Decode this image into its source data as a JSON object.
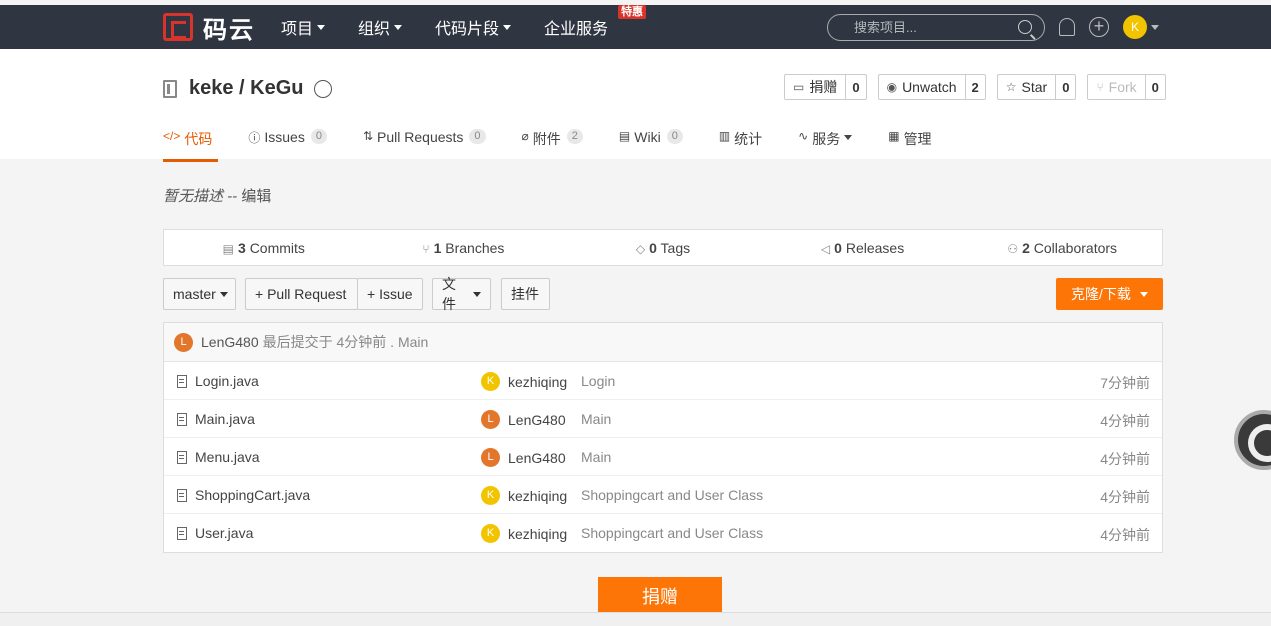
{
  "nav": {
    "logo_text": "码云",
    "items": [
      {
        "label": "项目",
        "dropdown": true
      },
      {
        "label": "组织",
        "dropdown": true
      },
      {
        "label": "代码片段",
        "dropdown": true
      },
      {
        "label": "企业服务",
        "dropdown": false,
        "badge": "特惠"
      }
    ],
    "search_placeholder": "搜索项目...",
    "avatar_letter": "K"
  },
  "repo": {
    "title": "keke / KeGu",
    "actions": [
      {
        "label": "捐赠",
        "count": "0",
        "disabled": false,
        "icon": "donate-icon"
      },
      {
        "label": "Unwatch",
        "count": "2",
        "disabled": false,
        "icon": "eye-icon"
      },
      {
        "label": "Star",
        "count": "0",
        "disabled": false,
        "icon": "star-icon"
      },
      {
        "label": "Fork",
        "count": "0",
        "disabled": true,
        "icon": "fork-icon"
      }
    ],
    "tabs": [
      {
        "label": "代码",
        "count": "",
        "active": true,
        "icon": "code-icon"
      },
      {
        "label": "Issues",
        "count": "0",
        "active": false,
        "icon": "issue-icon"
      },
      {
        "label": "Pull Requests",
        "count": "0",
        "active": false,
        "icon": "pull-request-icon"
      },
      {
        "label": "附件",
        "count": "2",
        "active": false,
        "icon": "attachment-icon"
      },
      {
        "label": "Wiki",
        "count": "0",
        "active": false,
        "icon": "wiki-icon"
      },
      {
        "label": "统计",
        "count": "",
        "active": false,
        "icon": "stats-icon"
      },
      {
        "label": "服务",
        "count": "",
        "active": false,
        "icon": "service-icon",
        "dropdown": true
      },
      {
        "label": "管理",
        "count": "",
        "active": false,
        "icon": "manage-icon"
      }
    ]
  },
  "description": {
    "text": "暂无描述",
    "separator": " -- ",
    "edit": "编辑"
  },
  "stats": [
    {
      "num": "3",
      "label": "Commits",
      "icon": "commits-icon"
    },
    {
      "num": "1",
      "label": "Branches",
      "icon": "branch-icon"
    },
    {
      "num": "0",
      "label": "Tags",
      "icon": "tag-icon"
    },
    {
      "num": "0",
      "label": "Releases",
      "icon": "release-icon"
    },
    {
      "num": "2",
      "label": "Collaborators",
      "icon": "collaborators-icon"
    }
  ],
  "toolbar": {
    "branch": "master",
    "pull_request": "+ Pull Request",
    "issue": "+ Issue",
    "file": "文件",
    "widget": "挂件",
    "clone": "克隆/下载"
  },
  "last_commit": {
    "avatar": "L",
    "author": "LenG480",
    "text": "最后提交于 4分钟前 . Main"
  },
  "files": [
    {
      "name": "Login.java",
      "avatar": "K",
      "user": "kezhiqing",
      "message": "Login",
      "time": "7分钟前"
    },
    {
      "name": "Main.java",
      "avatar": "L",
      "user": "LenG480",
      "message": "Main",
      "time": "4分钟前"
    },
    {
      "name": "Menu.java",
      "avatar": "L",
      "user": "LenG480",
      "message": "Main",
      "time": "4分钟前"
    },
    {
      "name": "ShoppingCart.java",
      "avatar": "K",
      "user": "kezhiqing",
      "message": "Shoppingcart and User Class",
      "time": "4分钟前"
    },
    {
      "name": "User.java",
      "avatar": "K",
      "user": "kezhiqing",
      "message": "Shoppingcart and User Class",
      "time": "4分钟前"
    }
  ],
  "donate_button": "捐赠",
  "colors": {
    "accent": "#fd7506",
    "nav_bg": "#303641",
    "active_tab": "#e65a00"
  }
}
